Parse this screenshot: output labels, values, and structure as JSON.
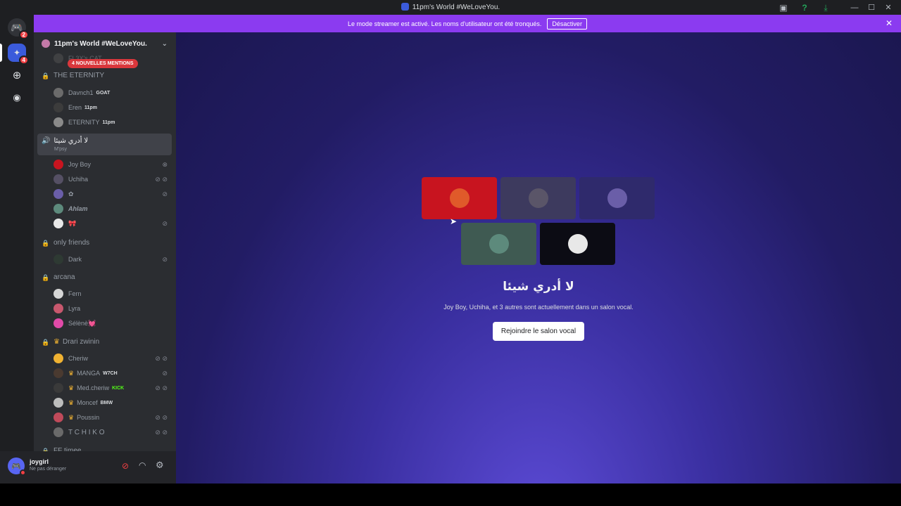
{
  "window": {
    "title": "11pm's World #WeLoveYou."
  },
  "rail": {
    "home_badge": "2",
    "server_badge": "4"
  },
  "banner": {
    "text": "Le mode streamer est activé. Les noms d'utilisateur ont été tronqués.",
    "button": "Désactiver"
  },
  "sidebar": {
    "server_name": "11pm's World #WeLoveYou.",
    "hidden_top": "FL3X's CAT",
    "mentions_pill": "4 NOUVELLES MENTIONS",
    "categories": {
      "eternity": "THE ETERNITY",
      "friends": "only friends",
      "arcana": "arcana",
      "drari": "Drari zwinin",
      "ff": "FF timee"
    },
    "eternity_members": [
      {
        "name": "Davnch1",
        "tag": "GOAT"
      },
      {
        "name": "Eren",
        "tag": "11pm"
      },
      {
        "name": "ETERNITY",
        "tag": "11pm"
      }
    ],
    "selected_channel": {
      "name": "لا أدري شيئا",
      "sub": "M'psy"
    },
    "channel_members": [
      {
        "name": "Joy Boy"
      },
      {
        "name": "Uchiha"
      },
      {
        "name": "✿"
      },
      {
        "name": "Ahlam"
      },
      {
        "name": "🎀"
      }
    ],
    "friends_members": [
      {
        "name": "Dark"
      }
    ],
    "arcana_members": [
      {
        "name": "Fern"
      },
      {
        "name": "Lyra"
      },
      {
        "name": "Sélènè💓"
      }
    ],
    "drari_members": [
      {
        "name": "Cheriw",
        "tag": ""
      },
      {
        "name": "MANGA",
        "tag": "W7CH"
      },
      {
        "name": "Med.cheriw",
        "tag": "KICK"
      },
      {
        "name": "Moncef",
        "tag": "BMW"
      },
      {
        "name": "Poussin",
        "tag": ""
      },
      {
        "name": "T C H I K O",
        "tag": ""
      }
    ]
  },
  "user": {
    "name": "joygirl",
    "status": "Ne pas déranger"
  },
  "voice": {
    "title": "لا أدري شيئا",
    "subtitle": "Joy Boy, Uchiha, et 3 autres sont actuellement dans un salon vocal.",
    "join_button": "Rejoindre le salon vocal"
  },
  "colors": {
    "banner": "#8b3bf0",
    "tile_joyboy": "#c8141f",
    "tile_uchiha": "#3d3a5e",
    "tile_3": "#2f2a6c",
    "tile_ahlam": "#3f5a52",
    "tile_5": "#0c0c14"
  }
}
